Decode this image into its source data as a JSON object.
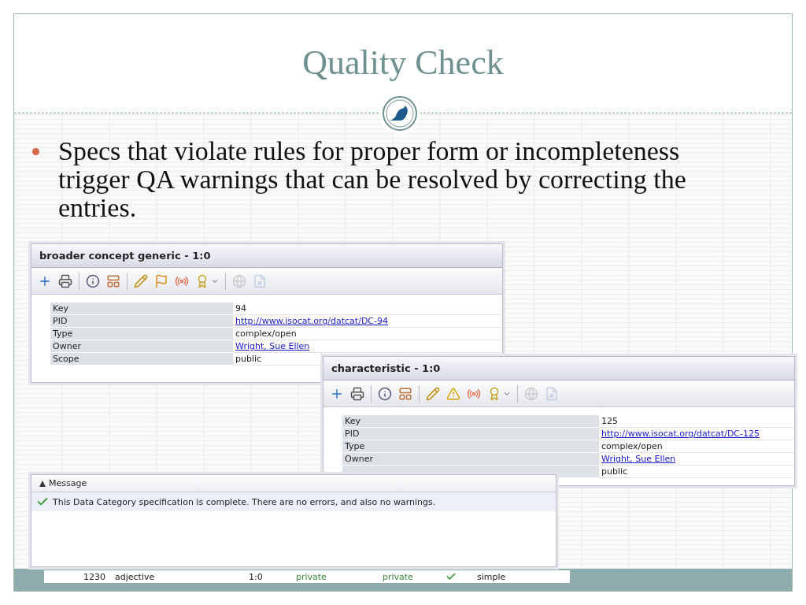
{
  "slide": {
    "title": "Quality Check",
    "bullets": [
      "Specs that violate rules for proper form or incompleteness trigger QA warnings that can be resolved by correcting the entries."
    ]
  },
  "panels": [
    {
      "title": "broader concept generic - 1:0",
      "toolbar": [
        {
          "kind": "add",
          "disabled": false
        },
        {
          "kind": "print",
          "disabled": false
        },
        {
          "kind": "sep"
        },
        {
          "kind": "info",
          "disabled": false
        },
        {
          "kind": "layout",
          "disabled": false
        },
        {
          "kind": "sep"
        },
        {
          "kind": "edit",
          "disabled": false
        },
        {
          "kind": "flag",
          "disabled": false
        },
        {
          "kind": "broadcast",
          "disabled": false
        },
        {
          "kind": "award",
          "disabled": false
        },
        {
          "kind": "sep"
        },
        {
          "kind": "globe",
          "disabled": true
        },
        {
          "kind": "file",
          "disabled": true
        }
      ],
      "rows": [
        {
          "label": "Key",
          "value": "94",
          "kind": "text"
        },
        {
          "label": "PID",
          "value": "http://www.isocat.org/datcat/DC-94",
          "kind": "link"
        },
        {
          "label": "Type",
          "value": "complex/open",
          "kind": "text"
        },
        {
          "label": "Owner",
          "value": "Wright, Sue Ellen",
          "kind": "link"
        },
        {
          "label": "Scope",
          "value": "public",
          "kind": "text"
        }
      ]
    },
    {
      "title": "characteristic - 1:0",
      "toolbar": [
        {
          "kind": "add",
          "disabled": false
        },
        {
          "kind": "print",
          "disabled": false
        },
        {
          "kind": "sep"
        },
        {
          "kind": "info",
          "disabled": false
        },
        {
          "kind": "layout",
          "disabled": false
        },
        {
          "kind": "sep"
        },
        {
          "kind": "edit",
          "disabled": false
        },
        {
          "kind": "warning",
          "disabled": false
        },
        {
          "kind": "broadcast",
          "disabled": false
        },
        {
          "kind": "award",
          "disabled": false
        },
        {
          "kind": "sep"
        },
        {
          "kind": "globe",
          "disabled": true
        },
        {
          "kind": "file",
          "disabled": true
        }
      ],
      "rows": [
        {
          "label": "Key",
          "value": "125",
          "kind": "text"
        },
        {
          "label": "PID",
          "value": "http://www.isocat.org/datcat/DC-125",
          "kind": "link"
        },
        {
          "label": "Type",
          "value": "complex/open",
          "kind": "text"
        },
        {
          "label": "Owner",
          "value": "Wright, Sue Ellen",
          "kind": "link"
        },
        {
          "value": "public",
          "kind": "text"
        }
      ]
    }
  ],
  "messages": {
    "column": {
      "label": "Message",
      "sorted_ascending": true
    },
    "items": [
      {
        "text": "This Data Category specification is complete. There are no errors, and also no warnings.",
        "kind": "success"
      }
    ]
  },
  "background_row": {
    "cells": [
      "1230",
      "adjective",
      "1:0",
      "private",
      "private",
      "simple"
    ],
    "checked": true
  }
}
